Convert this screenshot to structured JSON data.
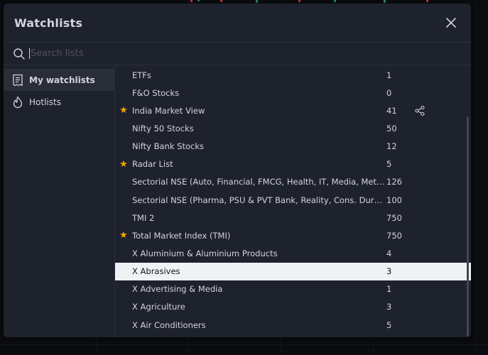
{
  "dialog": {
    "title": "Watchlists",
    "close_icon": "close-icon",
    "search": {
      "placeholder": "Search lists",
      "value": ""
    }
  },
  "sidebar": {
    "items": [
      {
        "label": "My watchlists",
        "icon": "list-icon",
        "active": true
      },
      {
        "label": "Hotlists",
        "icon": "flame-icon",
        "active": false
      }
    ]
  },
  "watchlists": [
    {
      "name": "ETFs",
      "count": "1",
      "starred": false
    },
    {
      "name": "F&O Stocks",
      "count": "0",
      "starred": false
    },
    {
      "name": "India Market View",
      "count": "41",
      "starred": true,
      "share_icon": "share-icon"
    },
    {
      "name": "Nifty 50 Stocks",
      "count": "50",
      "starred": false
    },
    {
      "name": "Nifty Bank Stocks",
      "count": "12",
      "starred": false
    },
    {
      "name": "Radar List",
      "count": "5",
      "starred": true
    },
    {
      "name": "Sectorial NSE (Auto, Financial, FMCG, Health, IT, Media, Metal)",
      "count": "126",
      "starred": false
    },
    {
      "name": "Sectorial NSE (Pharma, PSU & PVT Bank, Reality, Cons. Durable...",
      "count": "100",
      "starred": false
    },
    {
      "name": "TMI 2",
      "count": "750",
      "starred": false
    },
    {
      "name": "Total Market Index (TMI)",
      "count": "750",
      "starred": true
    },
    {
      "name": "X Aluminium & Aluminium Products",
      "count": "4",
      "starred": false
    },
    {
      "name": "X Abrasives",
      "count": "3",
      "starred": false,
      "selected": true
    },
    {
      "name": "X Advertising & Media",
      "count": "1",
      "starred": false
    },
    {
      "name": "X Agriculture",
      "count": "3",
      "starred": false
    },
    {
      "name": "X Air Conditioners",
      "count": "5",
      "starred": false
    }
  ],
  "colors": {
    "dialog_bg": "#1e222d",
    "star": "#f7a600",
    "selected_row": "#eff1f5",
    "text": "#d1d4dc"
  }
}
